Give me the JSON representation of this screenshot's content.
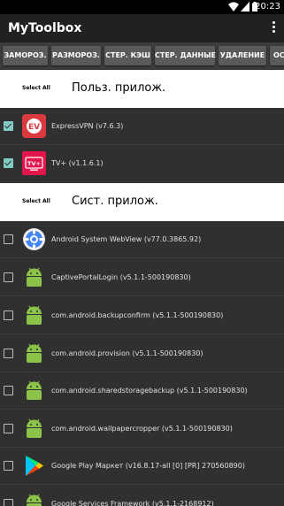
{
  "status_bar": {
    "time": "20:23"
  },
  "app_bar": {
    "title": "MyToolbox"
  },
  "toolbar": {
    "buttons": [
      "ЗАМОРОЗ.",
      "РАЗМОРОЗ.",
      "СТЕР. КЭШ",
      "СТЕР. ДАННЫЕ",
      "УДАЛЕНИЕ",
      "ОС"
    ]
  },
  "user_section": {
    "select_all": "Select All",
    "title": "Польз. прилож.",
    "apps": [
      {
        "label": "ExpressVPN (v7.6.3)",
        "checked": true,
        "icon": "expressvpn-icon"
      },
      {
        "label": "TV+ (v1.1.6.1)",
        "checked": true,
        "icon": "tvplus-icon"
      }
    ]
  },
  "system_section": {
    "select_all": "Select All",
    "title": "Сист. прилож.",
    "apps": [
      {
        "label": "Android System WebView (v77.0.3865.92)",
        "checked": false,
        "icon": "webview-icon"
      },
      {
        "label": "CaptivePortalLogin (v5.1.1-500190830)",
        "checked": false,
        "icon": "android-icon"
      },
      {
        "label": "com.android.backupconfirm (v5.1.1-500190830)",
        "checked": false,
        "icon": "android-icon"
      },
      {
        "label": "com.android.provision (v5.1.1-500190830)",
        "checked": false,
        "icon": "android-icon"
      },
      {
        "label": "com.android.sharedstoragebackup (v5.1.1-500190830)",
        "checked": false,
        "icon": "android-icon"
      },
      {
        "label": "com.android.wallpapercropper (v5.1.1-500190830)",
        "checked": false,
        "icon": "android-icon"
      },
      {
        "label": "Google Play Маркет (v16.8.17-all [0] [PR] 270560890)",
        "checked": false,
        "icon": "google-play-icon"
      },
      {
        "label": "Google Services Framework (v5.1.1-2168912)",
        "checked": false,
        "icon": "android-icon"
      }
    ]
  },
  "colors": {
    "accent": "#80cbc4",
    "appbar": "#212121",
    "background": "#303030"
  }
}
